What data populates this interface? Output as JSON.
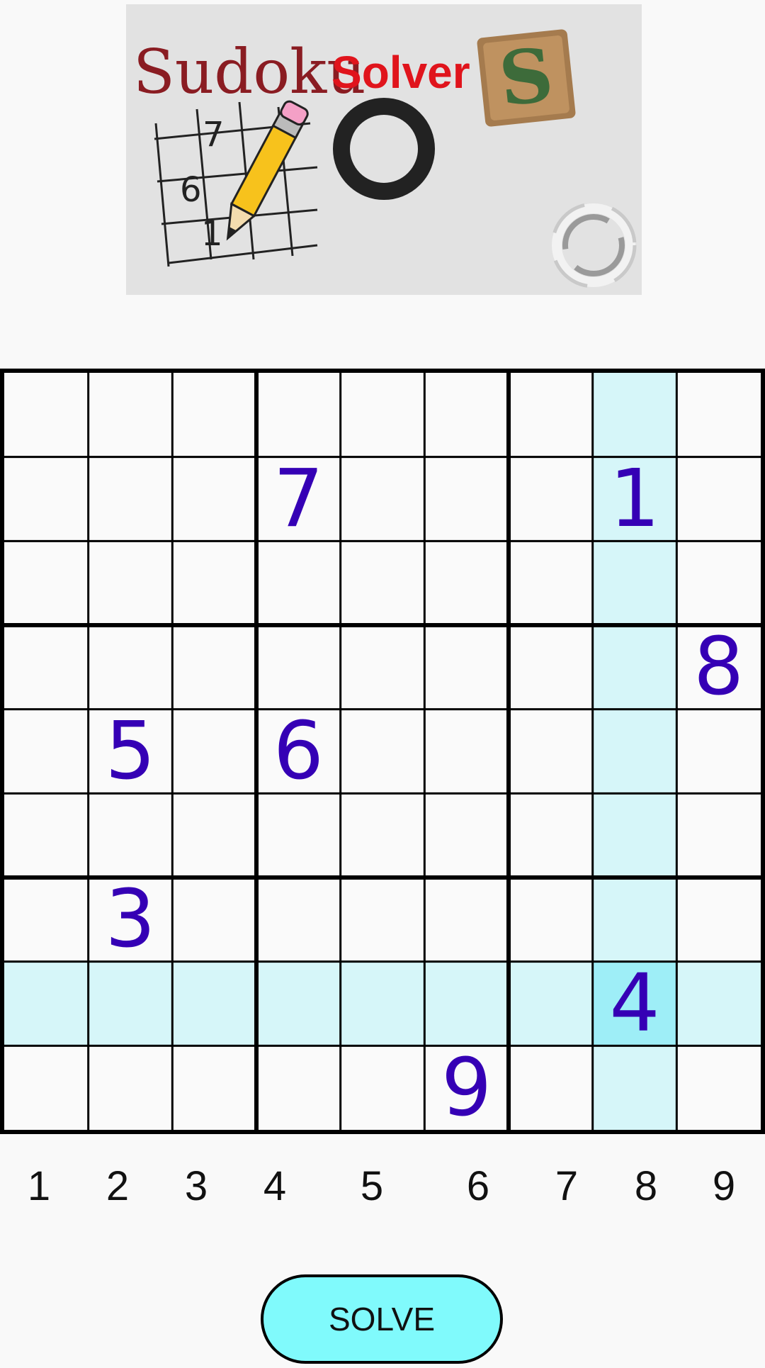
{
  "banner": {
    "logo_word_sudoku": "Sudoku",
    "logo_word_solver": "Solver",
    "logo_tile_letter": "S",
    "doodle_digits": [
      "7",
      "6",
      "1"
    ]
  },
  "board": {
    "size": 9,
    "givens": [
      {
        "row": 1,
        "col": 3,
        "value": "7"
      },
      {
        "row": 1,
        "col": 7,
        "value": "1"
      },
      {
        "row": 3,
        "col": 8,
        "value": "8"
      },
      {
        "row": 4,
        "col": 1,
        "value": "5"
      },
      {
        "row": 4,
        "col": 3,
        "value": "6"
      },
      {
        "row": 6,
        "col": 1,
        "value": "3"
      },
      {
        "row": 7,
        "col": 7,
        "value": "4"
      },
      {
        "row": 8,
        "col": 5,
        "value": "9"
      }
    ],
    "selected": {
      "row": 7,
      "col": 7
    },
    "colors": {
      "digit": "#3500b5",
      "highlight": "#d6f6f9",
      "selected": "#9eeef7",
      "grid": "#000000"
    }
  },
  "column_numbers": [
    "1",
    "2",
    "3",
    "4",
    "5",
    "6",
    "7",
    "8",
    "9"
  ],
  "solve_button": {
    "label": "SOLVE",
    "color": "#80fafc"
  }
}
